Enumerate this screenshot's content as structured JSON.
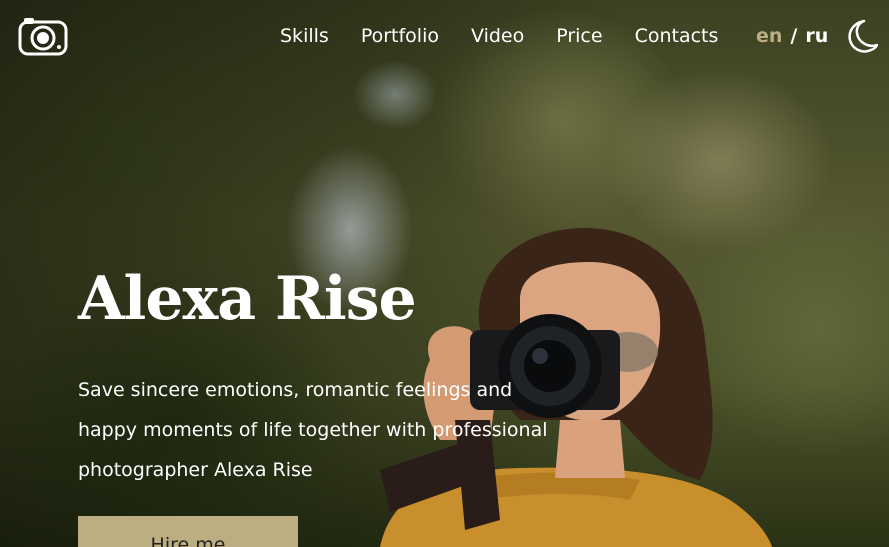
{
  "header": {
    "nav": [
      {
        "label": "Skills"
      },
      {
        "label": "Portfolio"
      },
      {
        "label": "Video"
      },
      {
        "label": "Price"
      },
      {
        "label": "Contacts"
      }
    ],
    "lang": {
      "active": "en",
      "separator": "/",
      "other": "ru"
    },
    "icons": {
      "logo": "camera-icon",
      "theme": "moon-icon"
    }
  },
  "hero": {
    "title": "Alexa Rise",
    "subtitle": "Save sincere emotions, romantic feelings and happy moments of life together with professional photographer Alexa Rise",
    "cta_label": "Hire me"
  },
  "colors": {
    "accent": "#bdae82",
    "text": "#ffffff"
  }
}
